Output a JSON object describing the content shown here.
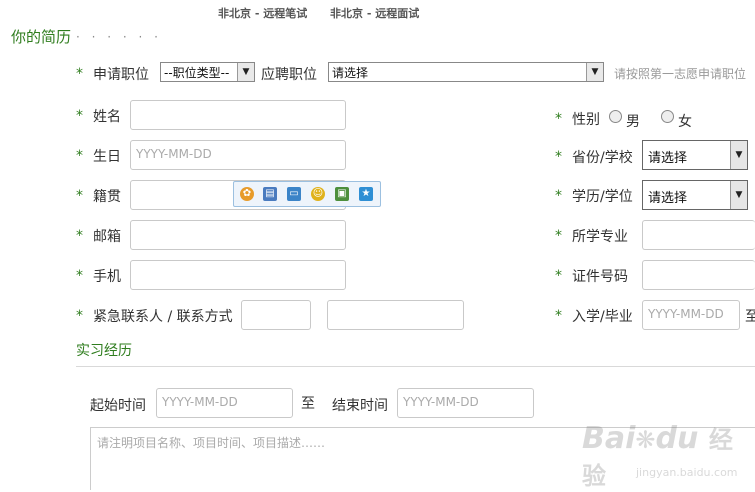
{
  "top_links": [
    "非北京 - 远程笔试",
    "非北京 - 远程面试"
  ],
  "resume": {
    "title": "你的简历",
    "dots": "· · · · · ·"
  },
  "required_mark": "*",
  "position": {
    "apply_label": "申请职位",
    "type_select": "--职位类型--",
    "hire_label": "应聘职位",
    "hire_select": "请选择",
    "hint": "请按照第一志愿申请职位"
  },
  "fields": {
    "name_label": "姓名",
    "birthday_label": "生日",
    "birthday_placeholder": "YYYY-MM-DD",
    "native_label": "籍贯",
    "email_label": "邮箱",
    "phone_label": "手机",
    "emergency_label": "紧急联系人 / 联系方式",
    "gender_label": "性别",
    "gender_male": "男",
    "gender_female": "女",
    "province_school_label": "省份/学校",
    "province_school_select": "请选择",
    "degree_label": "学历/学位",
    "degree_select": "请选择",
    "major_label": "所学专业",
    "id_label": "证件号码",
    "enroll_grad_label": "入学/毕业",
    "enroll_placeholder": "YYYY-MM-DD",
    "enroll_to": "至"
  },
  "toolbar_icons": [
    "palette-icon",
    "save-icon",
    "monitor-icon",
    "smiley-icon",
    "image-icon",
    "star-icon"
  ],
  "internship": {
    "title": "实习经历",
    "start_label": "起始时间",
    "start_placeholder": "YYYY-MM-DD",
    "to": "至",
    "end_label": "结束时间",
    "end_placeholder": "YYYY-MM-DD",
    "desc_placeholder": "请注明项目名称、项目时间、项目描述……"
  },
  "watermark": {
    "brand": "Bai",
    "brand2": "du",
    "cn": "经验",
    "url": "jingyan.baidu.com"
  }
}
